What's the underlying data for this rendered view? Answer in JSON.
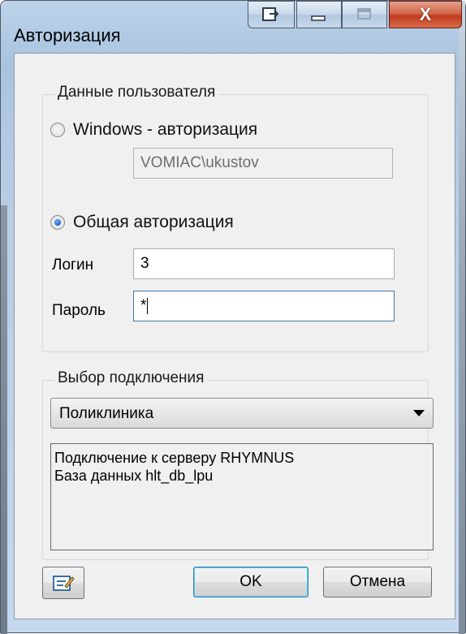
{
  "window": {
    "title": "Авторизация"
  },
  "title_buttons": {
    "extra_icon": "window-switch-icon",
    "minimize_icon": "minimize-icon",
    "maximize_icon": "maximize-icon",
    "close_label": "X"
  },
  "user_group": {
    "legend": "Данные пользователя",
    "windows_auth_label": "Windows - авторизация",
    "windows_auth_checked": false,
    "windows_user": "VOMIAC\\ukustov",
    "common_auth_label": "Общая авторизация",
    "common_auth_checked": true,
    "login_label": "Логин",
    "login_value": "3",
    "password_label": "Пароль",
    "password_value": "*"
  },
  "connection_group": {
    "legend": "Выбор подключения",
    "selected_connection": "Поликлиника",
    "info_line1": "Подключение к серверу RHYMNUS",
    "info_line2": "База данных hlt_db_lpu"
  },
  "buttons": {
    "edit_icon": "edit-connection-icon",
    "ok_label": "OK",
    "cancel_label": "Отмена"
  },
  "colors": {
    "titlebar": "#b7cde6",
    "close_button": "#c23a1e",
    "client_bg": "#f0f0f0",
    "radio_selected": "#1a62c6"
  }
}
